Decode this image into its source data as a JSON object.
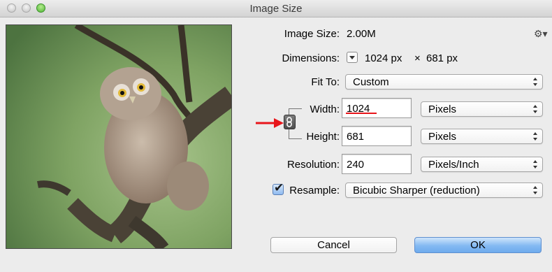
{
  "window": {
    "title": "Image Size"
  },
  "info": {
    "image_size_label": "Image Size:",
    "image_size_value": "2.00M",
    "dimensions_label": "Dimensions:",
    "dim_width": "1024 px",
    "dim_times": "×",
    "dim_height": "681 px"
  },
  "fit_to": {
    "label": "Fit To:",
    "value": "Custom"
  },
  "width": {
    "label": "Width:",
    "value": "1024",
    "unit": "Pixels"
  },
  "height": {
    "label": "Height:",
    "value": "681",
    "unit": "Pixels"
  },
  "resolution": {
    "label": "Resolution:",
    "value": "240",
    "unit": "Pixels/Inch"
  },
  "resample": {
    "label": "Resample:",
    "checked": true,
    "method": "Bicubic Sharper (reduction)"
  },
  "buttons": {
    "cancel": "Cancel",
    "ok": "OK"
  },
  "annotation": {
    "arrow_color": "#e8161b",
    "underline_color": "#e8161b"
  },
  "icons": {
    "settings": "gear-icon",
    "dimensions_menu": "dropdown-triangle-icon",
    "constrain": "chain-link-icon"
  }
}
